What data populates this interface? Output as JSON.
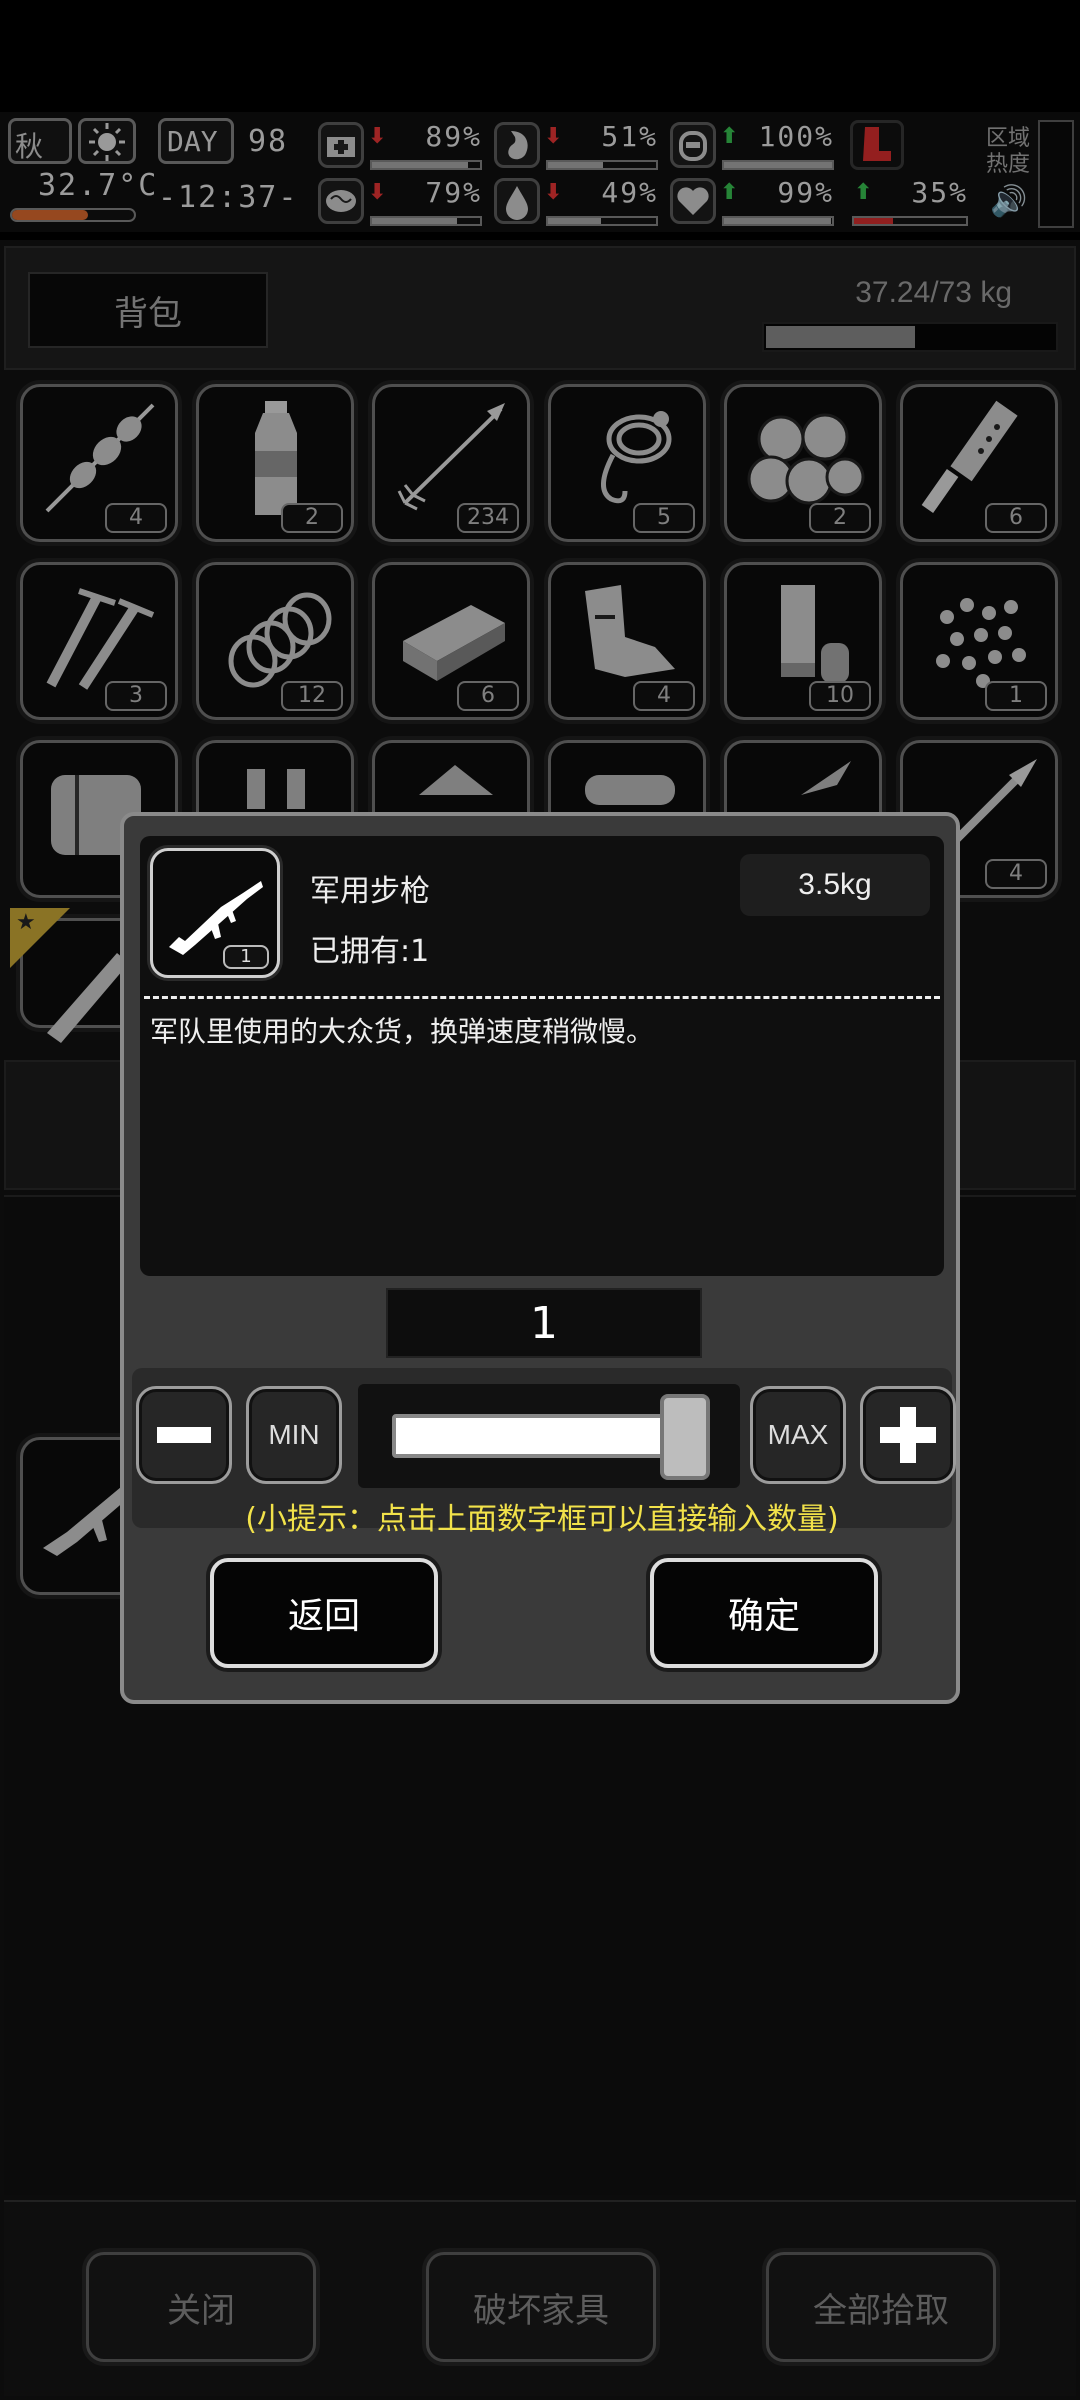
{
  "status": {
    "season": "秋",
    "day_label": "DAY",
    "day_number": "98",
    "temperature": "32.7°C",
    "time": "-12:37-",
    "region_heat_label": "区域\n热度",
    "stats": [
      {
        "icon": "medkit-icon",
        "value": "89%",
        "trend": "down",
        "level": 0.89
      },
      {
        "icon": "stomach-icon",
        "value": "51%",
        "trend": "down",
        "level": 0.51
      },
      {
        "icon": "battery-icon",
        "value": "100%",
        "trend": "up",
        "level": 1.0
      },
      {
        "icon": "boot-icon",
        "value": "",
        "trend": "",
        "level": 0
      },
      {
        "icon": "brain-icon",
        "value": "79%",
        "trend": "down",
        "level": 0.79
      },
      {
        "icon": "water-drop-icon",
        "value": "49%",
        "trend": "down",
        "level": 0.49
      },
      {
        "icon": "heart-icon",
        "value": "99%",
        "trend": "up",
        "level": 0.99
      },
      {
        "icon": "stamina-icon",
        "value": "35%",
        "trend": "up",
        "level": 0.35
      }
    ],
    "colors": {
      "down": "#d33030",
      "up": "#33b04a",
      "stamina_fill": "#c02a2a"
    }
  },
  "backpack": {
    "tab_label": "背包",
    "weight": "37.24/73 kg",
    "weight_fraction": 0.51,
    "items": [
      {
        "icon": "skewer-icon",
        "count": "4"
      },
      {
        "icon": "water-bottle-icon",
        "count": "2"
      },
      {
        "icon": "arrow-icon",
        "count": "234"
      },
      {
        "icon": "rope-hook-icon",
        "count": "5"
      },
      {
        "icon": "cotton-icon",
        "count": "2"
      },
      {
        "icon": "tool-handle-icon",
        "count": "6"
      },
      {
        "icon": "nails-icon",
        "count": "3"
      },
      {
        "icon": "spring-icon",
        "count": "12"
      },
      {
        "icon": "plank-icon",
        "count": "6"
      },
      {
        "icon": "scrap-metal-icon",
        "count": "4"
      },
      {
        "icon": "shell-icon",
        "count": "10"
      },
      {
        "icon": "pellets-icon",
        "count": "1"
      },
      {
        "icon": "wood-log-icon",
        "count": ""
      },
      {
        "icon": "bottles-icon",
        "count": ""
      },
      {
        "icon": "cloth-icon",
        "count": ""
      },
      {
        "icon": "roll-icon",
        "count": ""
      },
      {
        "icon": "blade-icon",
        "count": ""
      },
      {
        "icon": "spear-icon",
        "count": "4"
      }
    ]
  },
  "bottom_buttons": {
    "close": "关闭",
    "destroy_furniture": "破坏家具",
    "pick_all": "全部拾取"
  },
  "dialog": {
    "item_name": "军用步枪",
    "owned": "已拥有:1",
    "weight": "3.5kg",
    "item_count": "1",
    "description": "军队里使用的大众货，换弹速度稍微慢。",
    "quantity": "1",
    "slider_fraction": 1.0,
    "min_label": "MIN",
    "max_label": "MAX",
    "hint": "(小提示：点击上面数字框可以直接输入数量)",
    "back_label": "返回",
    "confirm_label": "确定",
    "hint_color": "#f2e24a"
  }
}
